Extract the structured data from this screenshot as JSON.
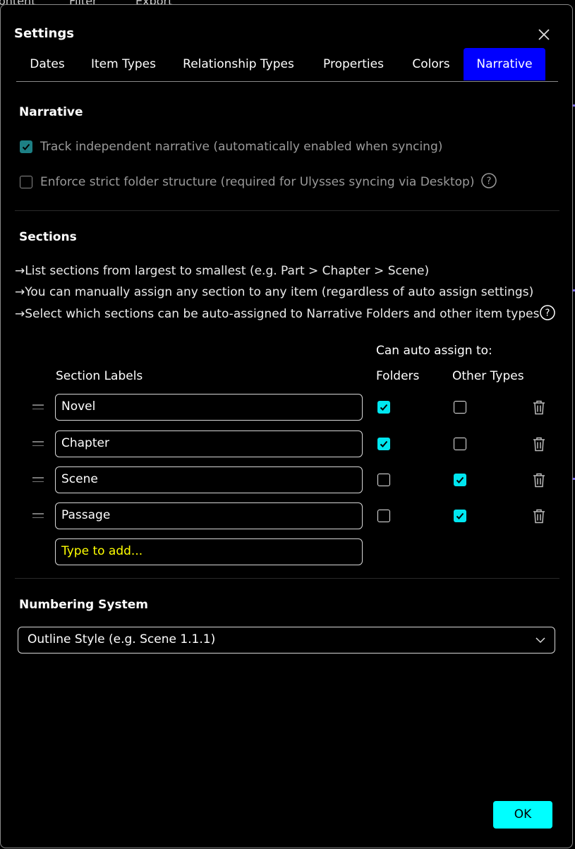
{
  "background": {
    "items": [
      "ontent",
      "Filter",
      "Export"
    ]
  },
  "dialog": {
    "title": "Settings",
    "tabs": [
      "Dates",
      "Item Types",
      "Relationship Types",
      "Properties",
      "Colors",
      "Narrative"
    ],
    "active_tab": "Narrative",
    "narrative": {
      "heading": "Narrative",
      "track_label": "Track independent narrative (automatically enabled when syncing)",
      "track_checked": true,
      "enforce_label": "Enforce strict folder structure (required for Ulysses syncing via Desktop)",
      "enforce_checked": false
    },
    "sections": {
      "heading": "Sections",
      "bullets": [
        "List sections from largest to smallest (e.g. Part > Chapter > Scene)",
        "You can manually assign any section to any item (regardless of auto assign settings)",
        "Select which sections can be auto-assigned to Narrative Folders and other item types"
      ],
      "can_auto_assign": "Can auto assign to:",
      "col_labels": "Section Labels",
      "col_folders": "Folders",
      "col_other": "Other Types",
      "rows": [
        {
          "label": "Novel",
          "folders": true,
          "other": false
        },
        {
          "label": "Chapter",
          "folders": true,
          "other": false
        },
        {
          "label": "Scene",
          "folders": false,
          "other": true
        },
        {
          "label": "Passage",
          "folders": false,
          "other": true
        }
      ],
      "add_placeholder": "Type to add..."
    },
    "numbering": {
      "heading": "Numbering System",
      "selected": "Outline Style (e.g. Scene 1.1.1)"
    },
    "ok_label": "OK"
  },
  "colors": {
    "active_tab": "#0000ff",
    "accent": "#00ffff",
    "placeholder": "#ffff00"
  }
}
